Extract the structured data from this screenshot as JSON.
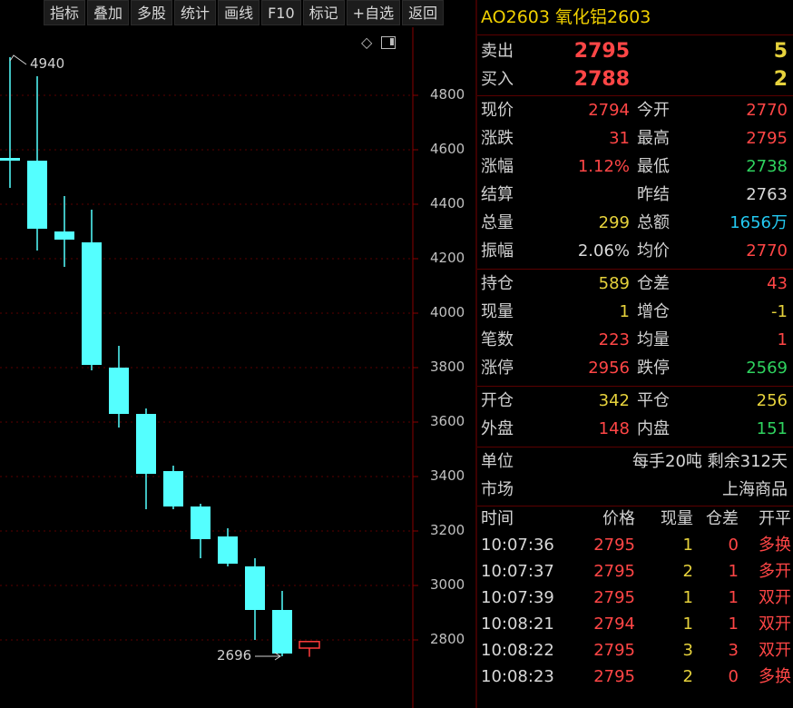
{
  "toolbar": {
    "buttons": [
      "指标",
      "叠加",
      "多股",
      "统计",
      "画线",
      "F10",
      "标记",
      "+自选",
      "返回"
    ]
  },
  "chart": {
    "y_ticks": [
      "4800",
      "4600",
      "4400",
      "4200",
      "4000",
      "3800",
      "3600",
      "3400",
      "3200",
      "3000",
      "2800"
    ],
    "high_annotation": "4940",
    "low_annotation": "2696"
  },
  "chart_data": {
    "type": "candlestick",
    "ylim": [
      2650,
      5000
    ],
    "candles": [
      {
        "open": 4570,
        "close": 4560,
        "high": 4940,
        "low": 4460
      },
      {
        "open": 4560,
        "close": 4310,
        "high": 4870,
        "low": 4230
      },
      {
        "open": 4300,
        "close": 4270,
        "high": 4430,
        "low": 4170
      },
      {
        "open": 4260,
        "close": 3810,
        "high": 4380,
        "low": 3790
      },
      {
        "open": 3800,
        "close": 3630,
        "high": 3880,
        "low": 3580
      },
      {
        "open": 3630,
        "close": 3410,
        "high": 3650,
        "low": 3280
      },
      {
        "open": 3420,
        "close": 3290,
        "high": 3440,
        "low": 3280
      },
      {
        "open": 3290,
        "close": 3170,
        "high": 3300,
        "low": 3100
      },
      {
        "open": 3180,
        "close": 3080,
        "high": 3210,
        "low": 3070
      },
      {
        "open": 3070,
        "close": 2910,
        "high": 3100,
        "low": 2800
      },
      {
        "open": 2910,
        "close": 2750,
        "high": 2980,
        "low": 2740
      },
      {
        "open": 2770,
        "close": 2794,
        "high": 2795,
        "low": 2738
      }
    ],
    "colors": {
      "down": "#54ffff",
      "up": "#ff3c3c"
    }
  },
  "quote": {
    "title": "AO2603 氧化铝2603",
    "ask_label": "卖出",
    "ask_price": "2795",
    "ask_vol": "5",
    "bid_label": "买入",
    "bid_price": "2788",
    "bid_vol": "2",
    "rows1": [
      {
        "l1": "现价",
        "v1": "2794",
        "c1": "red",
        "l2": "今开",
        "v2": "2770",
        "c2": "red"
      },
      {
        "l1": "涨跌",
        "v1": "31",
        "c1": "red",
        "l2": "最高",
        "v2": "2795",
        "c2": "red"
      },
      {
        "l1": "涨幅",
        "v1": "1.12%",
        "c1": "red",
        "l2": "最低",
        "v2": "2738",
        "c2": "green"
      },
      {
        "l1": "结算",
        "v1": "",
        "c1": "white",
        "l2": "昨结",
        "v2": "2763",
        "c2": "white"
      },
      {
        "l1": "总量",
        "v1": "299",
        "c1": "yellow",
        "l2": "总额",
        "v2": "1656万",
        "c2": "cyan"
      },
      {
        "l1": "振幅",
        "v1": "2.06%",
        "c1": "white",
        "l2": "均价",
        "v2": "2770",
        "c2": "red"
      }
    ],
    "rows2": [
      {
        "l1": "持仓",
        "v1": "589",
        "c1": "yellow",
        "l2": "仓差",
        "v2": "43",
        "c2": "red"
      },
      {
        "l1": "现量",
        "v1": "1",
        "c1": "yellow",
        "l2": "增仓",
        "v2": "-1",
        "c2": "yellow"
      },
      {
        "l1": "笔数",
        "v1": "223",
        "c1": "red",
        "l2": "均量",
        "v2": "1",
        "c2": "red"
      },
      {
        "l1": "涨停",
        "v1": "2956",
        "c1": "red",
        "l2": "跌停",
        "v2": "2569",
        "c2": "green"
      }
    ],
    "rows3": [
      {
        "l1": "开仓",
        "v1": "342",
        "c1": "yellow",
        "l2": "平仓",
        "v2": "256",
        "c2": "yellow"
      },
      {
        "l1": "外盘",
        "v1": "148",
        "c1": "red",
        "l2": "内盘",
        "v2": "151",
        "c2": "green"
      }
    ],
    "unit_label": "单位",
    "unit_value": "每手20吨  剩余312天",
    "market_label": "市场",
    "market_value": "上海商品"
  },
  "trades": {
    "headers": [
      "时间",
      "价格",
      "现量",
      "仓差",
      "开平"
    ],
    "rows": [
      {
        "time": "10:07:36",
        "price": "2795",
        "vol": "1",
        "oi": "0",
        "type": "多换"
      },
      {
        "time": "10:07:37",
        "price": "2795",
        "vol": "2",
        "oi": "1",
        "type": "多开"
      },
      {
        "time": "10:07:39",
        "price": "2795",
        "vol": "1",
        "oi": "1",
        "type": "双开"
      },
      {
        "time": "10:08:21",
        "price": "2794",
        "vol": "1",
        "oi": "1",
        "type": "双开"
      },
      {
        "time": "10:08:22",
        "price": "2795",
        "vol": "3",
        "oi": "3",
        "type": "双开"
      },
      {
        "time": "10:08:23",
        "price": "2795",
        "vol": "2",
        "oi": "0",
        "type": "多换"
      }
    ]
  }
}
